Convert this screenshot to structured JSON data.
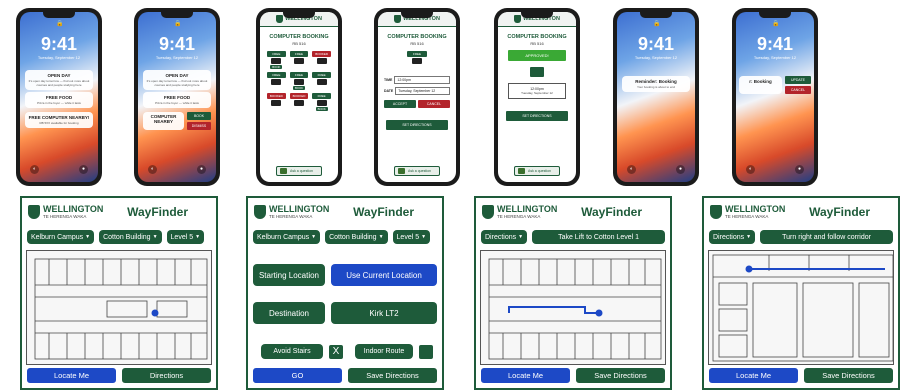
{
  "lock": {
    "time": "9:41",
    "date": "Tuesday, September 12",
    "notifications": [
      {
        "title": "OPEN DAY",
        "body": "It's open day tomorrow — find out more about courses and people studying here"
      },
      {
        "title": "FREE FOOD",
        "body": "Pizza in the foyer — while it lasts"
      },
      {
        "title": "FREE COMPUTER NEARBY!",
        "body": "RB 5XX available for booking"
      }
    ],
    "computer_label": "COMPUTER NEARBY",
    "book_label": "BOOK",
    "dismiss_label": "DISMISS",
    "reminder_title": "Reminder: Booking",
    "reminder_title_short": "r: Booking",
    "reminder_body": "Your booking is about to end",
    "update_label": "UPDATE",
    "cancel_label": "CANCEL"
  },
  "booking": {
    "university": "WELLINGTON",
    "title": "COMPUTER BOOKING",
    "room": "RB 516",
    "free": "FREE",
    "booked": "BOOKED",
    "book": "BOOK",
    "time_label": "TIME",
    "time_value": "12:00pm",
    "date_label": "DATE",
    "date_value": "Tuesday, September 12",
    "accept": "ACCEPT",
    "cancel": "CANCEL",
    "approved": "APPROVED!",
    "set_directions": "SET DIRECTIONS",
    "ask": "Ask a question"
  },
  "wayfinder": {
    "university_small": "TE HERENGA WAKA",
    "university": "WELLINGTON",
    "title": "WayFinder",
    "campus": "Kelburn Campus",
    "building": "Cotton Building",
    "level": "Level 5",
    "locate_me": "Locate Me",
    "directions": "Directions",
    "starting_location": "Starting Location",
    "use_current_location": "Use Current Location",
    "destination": "Destination",
    "destination_value": "Kirk LT2",
    "avoid_stairs": "Avoid Stairs",
    "x_mark": "X",
    "indoor_route": "Indoor Route",
    "go": "GO",
    "save_directions": "Save Directions",
    "step1": "Take Lift to Cotton Level 1",
    "step2": "Turn right and follow corridor"
  },
  "colors": {
    "brand_green": "#1e5b3a",
    "action_blue": "#1d49c6",
    "danger_red": "#b3242b"
  }
}
